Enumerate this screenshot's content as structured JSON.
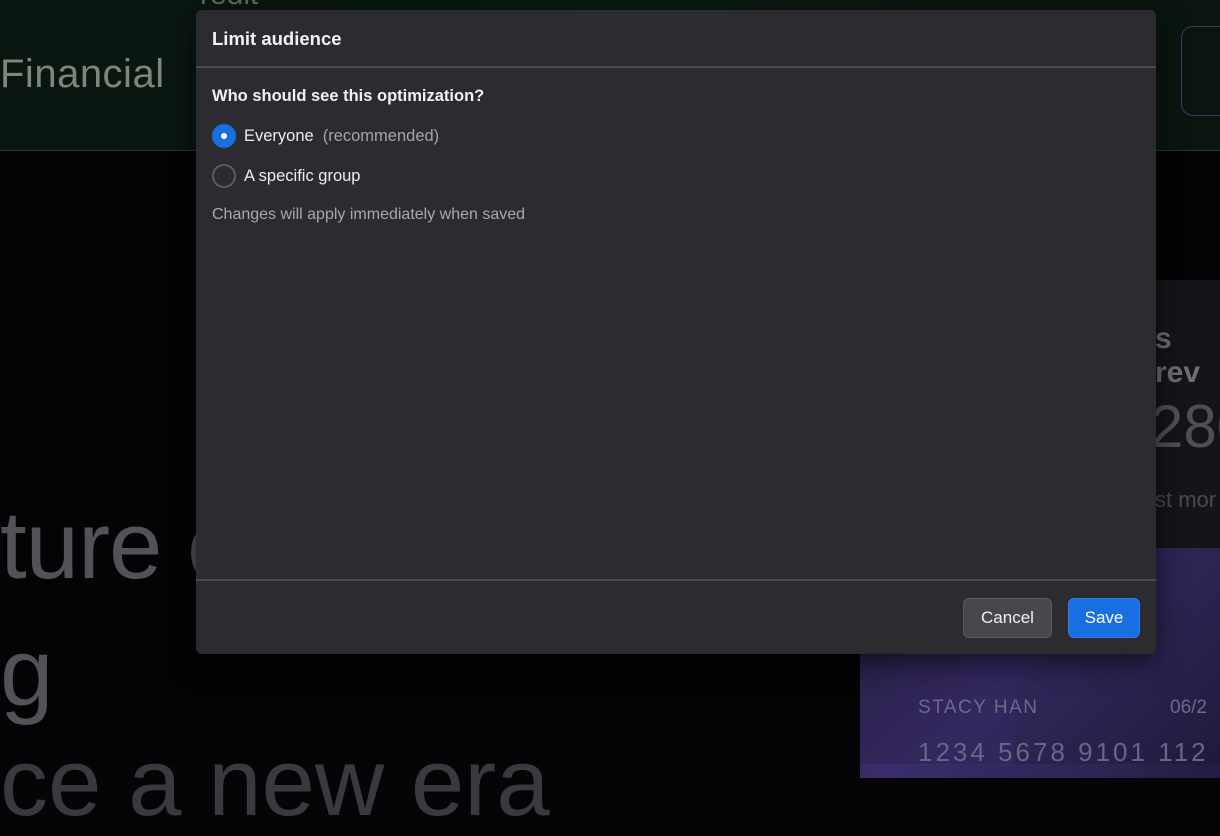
{
  "background": {
    "header": {
      "brand_text": "Financial",
      "partial_text": "redit"
    },
    "hero_lines": [
      "ture o",
      "g",
      "ce a new era"
    ],
    "panel": {
      "title_partial": "s rev",
      "value_partial": "280",
      "subtitle_partial": "st mor"
    },
    "card": {
      "holder": "STACY HAN",
      "expiry_partial": "06/2",
      "number_partial": "1234 5678 9101 112"
    }
  },
  "modal": {
    "title": "Limit audience",
    "question": "Who should see this optimization?",
    "options": [
      {
        "label": "Everyone",
        "note": "(recommended)",
        "selected": true
      },
      {
        "label": "A specific group",
        "note": "",
        "selected": false
      }
    ],
    "helper_text": "Changes will apply immediately when saved",
    "buttons": {
      "cancel": "Cancel",
      "save": "Save"
    }
  },
  "colors": {
    "accent": "#1a6fe0",
    "modal_bg": "#2c2b30",
    "page_bg": "#050507"
  }
}
